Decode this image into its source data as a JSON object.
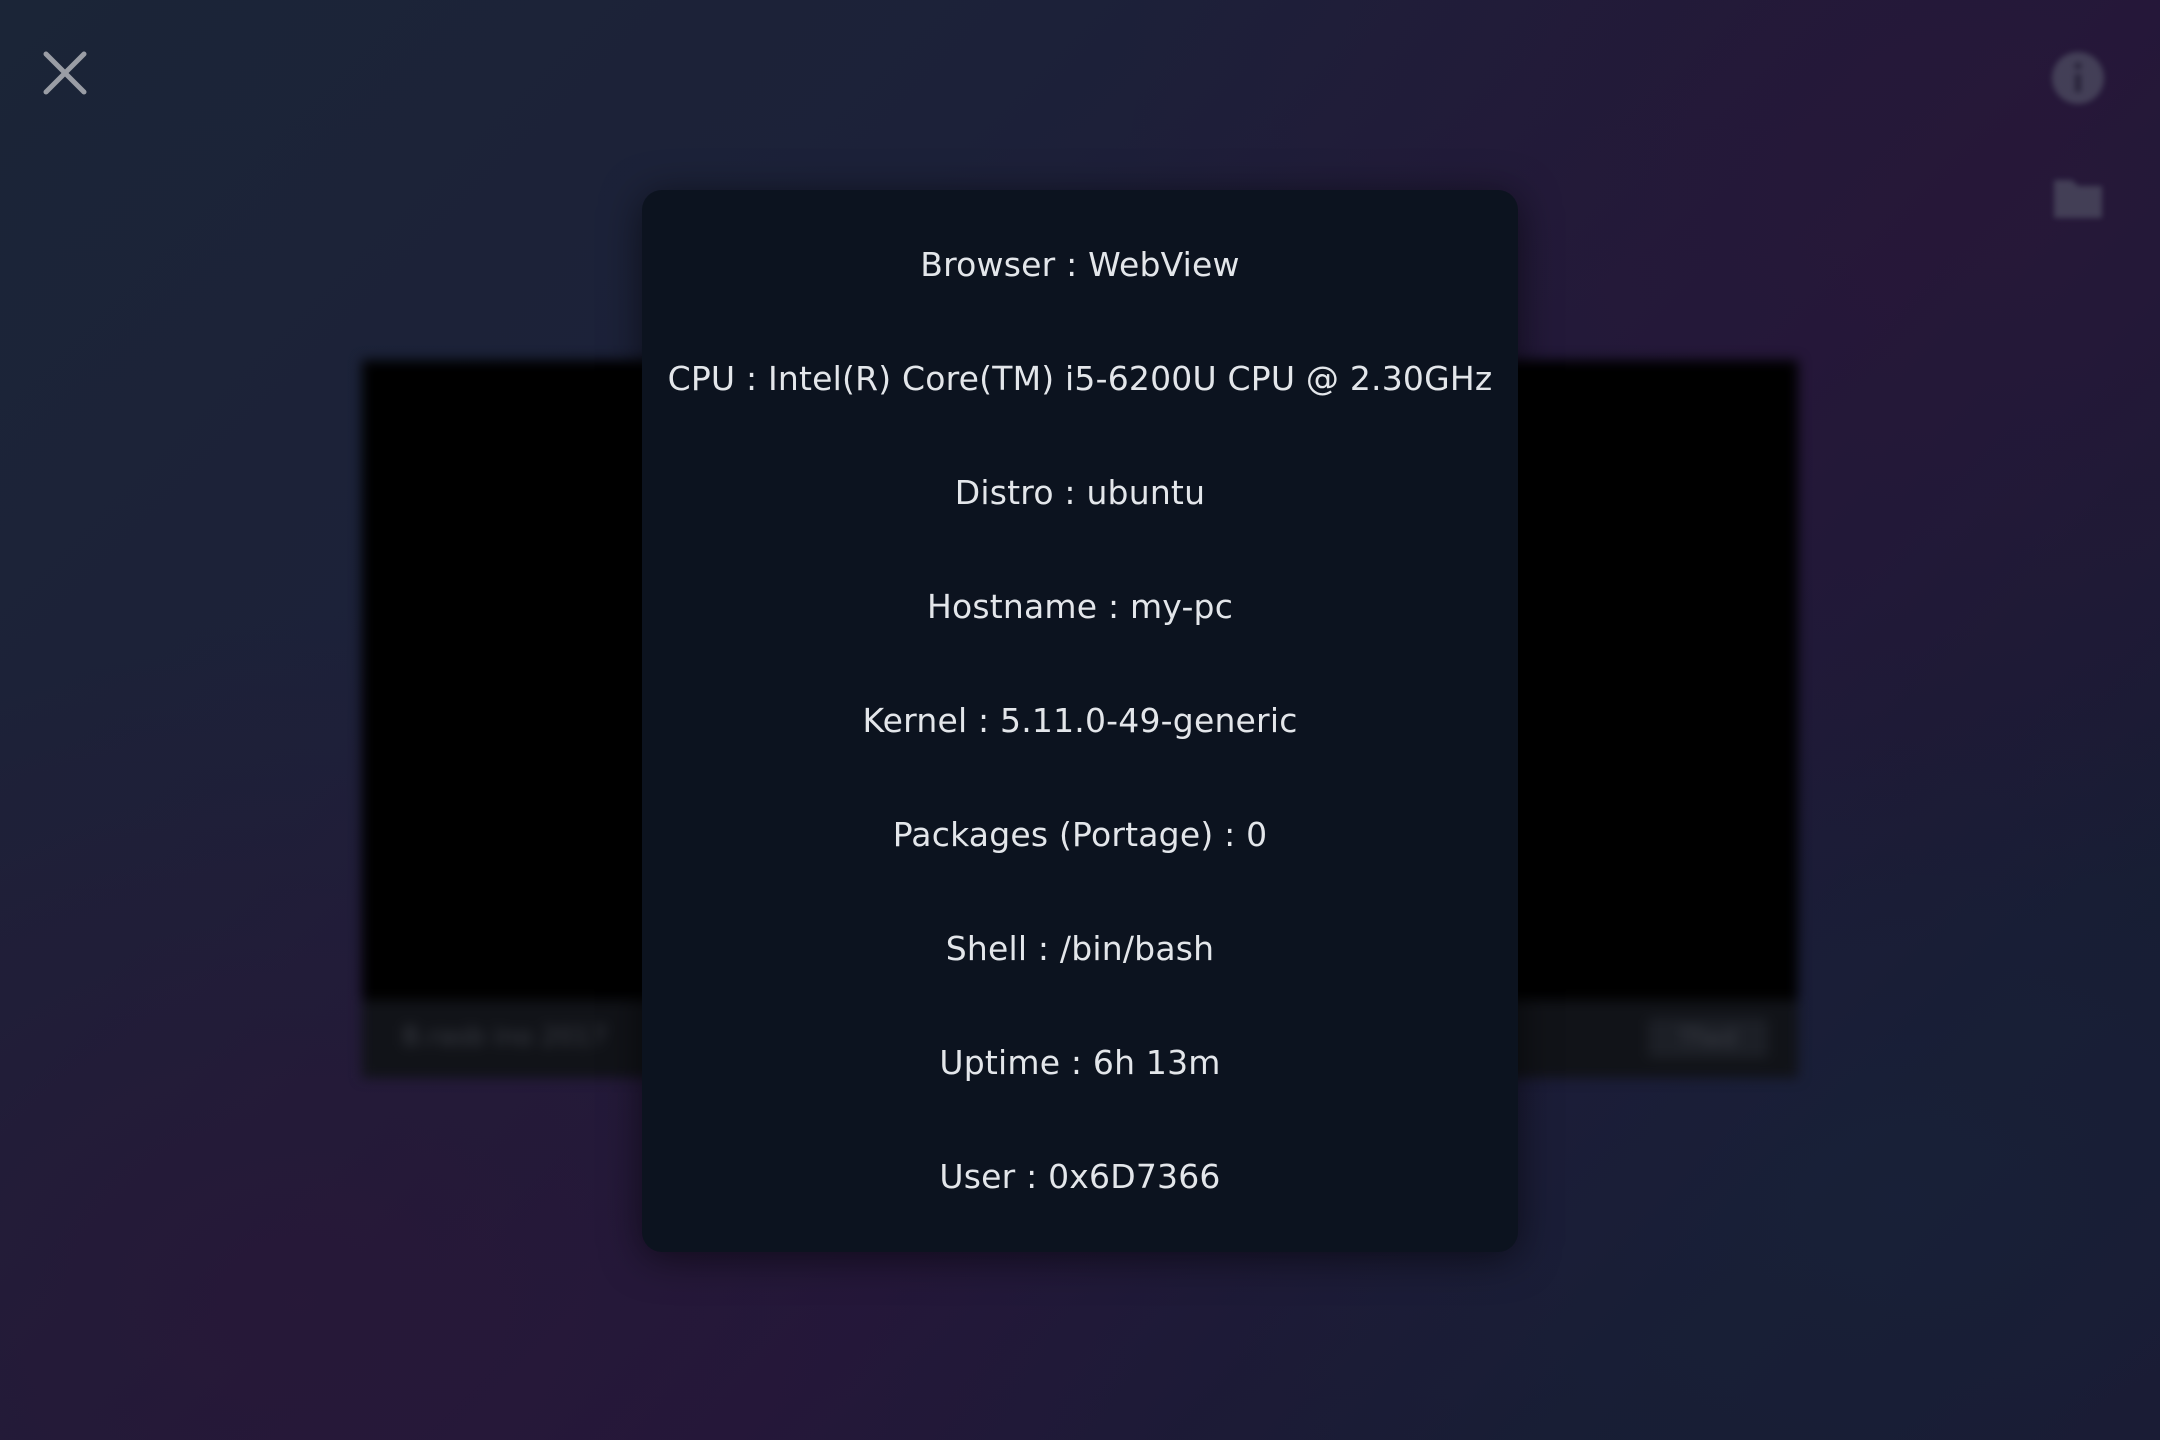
{
  "window": {
    "close_icon": "close-icon",
    "right_icons": [
      "info-icon",
      "folder-icon"
    ]
  },
  "background_window": {
    "footer_left": "B.rasb ino 2017",
    "footer_right": "Tfwd"
  },
  "system_info": {
    "rows": [
      "Browser : WebView",
      "CPU : Intel(R) Core(TM) i5-6200U CPU @ 2.30GHz",
      "Distro : ubuntu",
      "Hostname : my-pc",
      "Kernel : 5.11.0-49-generic",
      "Packages (Portage) : 0",
      "Shell : /bin/bash",
      "Uptime : 6h 13m",
      "User : 0x6D7366"
    ]
  },
  "colors": {
    "card_background": "#0c131f",
    "text": "#e3e6ea",
    "close_icon": "#9a9da5"
  }
}
